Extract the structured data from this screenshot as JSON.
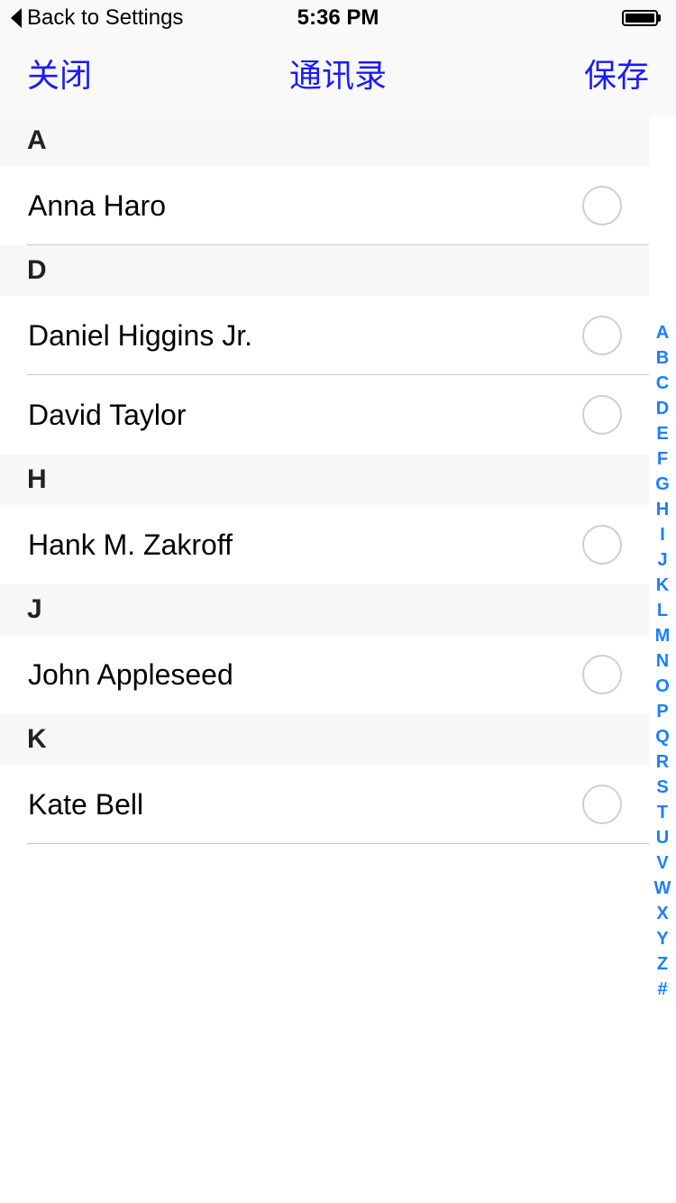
{
  "status_bar": {
    "back_label": "Back to Settings",
    "time": "5:36 PM",
    "battery_icon": "battery-full-icon"
  },
  "nav": {
    "close_label": "关闭",
    "title": "通讯录",
    "save_label": "保存"
  },
  "colors": {
    "accent": "#1a1aff",
    "index": "#1a7fff",
    "section_bg": "#f7f7f7",
    "separator": "#c8c7cc"
  },
  "sections": [
    {
      "letter": "A",
      "contacts": [
        "Anna Haro"
      ]
    },
    {
      "letter": "D",
      "contacts": [
        "Daniel Higgins Jr.",
        "David Taylor"
      ]
    },
    {
      "letter": "H",
      "contacts": [
        "Hank M. Zakroff"
      ]
    },
    {
      "letter": "J",
      "contacts": [
        "John Appleseed"
      ]
    },
    {
      "letter": "K",
      "contacts": [
        "Kate Bell"
      ]
    }
  ],
  "index_letters": [
    "A",
    "B",
    "C",
    "D",
    "E",
    "F",
    "G",
    "H",
    "I",
    "J",
    "K",
    "L",
    "M",
    "N",
    "O",
    "P",
    "Q",
    "R",
    "S",
    "T",
    "U",
    "V",
    "W",
    "X",
    "Y",
    "Z",
    "#"
  ]
}
